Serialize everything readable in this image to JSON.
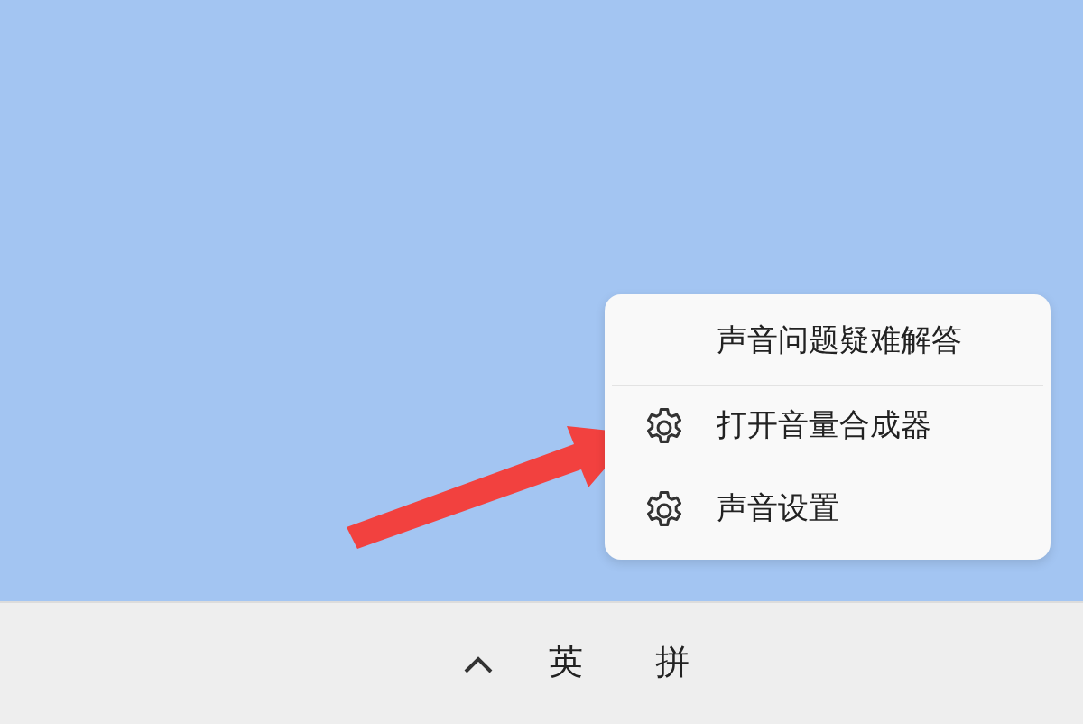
{
  "context_menu": {
    "items": [
      {
        "kind": "plain",
        "label": "声音问题疑难解答"
      },
      {
        "kind": "settings",
        "label": "打开音量合成器"
      },
      {
        "kind": "settings",
        "label": "声音设置"
      }
    ]
  },
  "taskbar": {
    "input_indicators": [
      "英",
      "拼"
    ]
  }
}
